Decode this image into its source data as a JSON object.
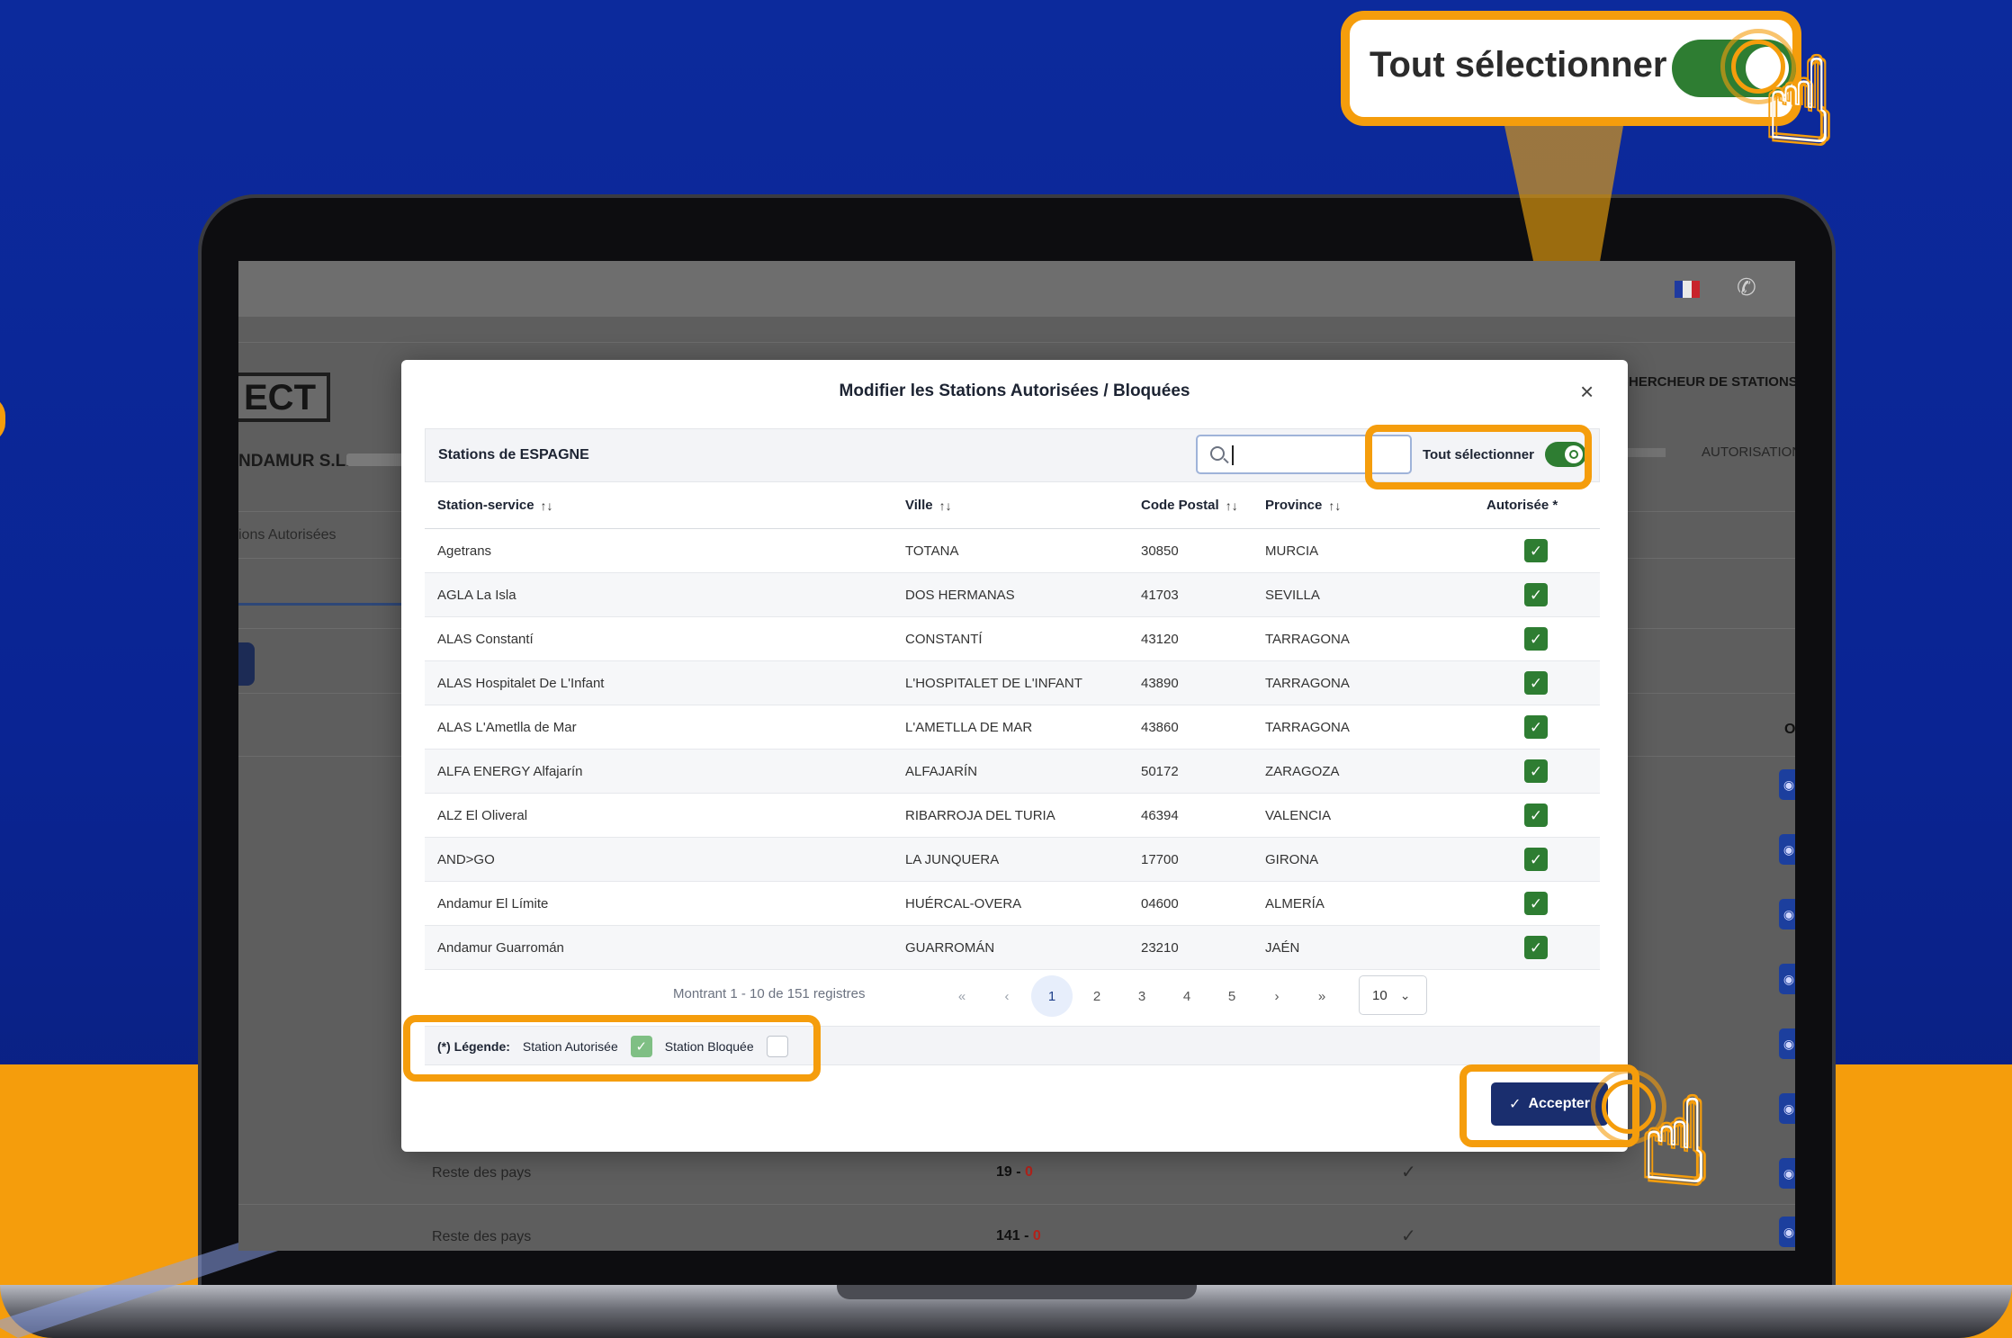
{
  "background_app": {
    "brand_logo_fragment": "ECT",
    "company_name": "NDAMUR S.L.",
    "tab_label": "ions Autorisées",
    "header_nav": "HERCHEUR DE STATIONS",
    "autorisation_label": "AUTORISATION",
    "column_fragment": "O",
    "rows": [
      {
        "label": "Reste des pays",
        "value_a": "19",
        "value_b": "0"
      },
      {
        "label": "Reste des pays",
        "value_a": "141",
        "value_b": "0"
      }
    ],
    "separator": " - ",
    "check_glyph": "✓"
  },
  "modal": {
    "title": "Modifier les Stations Autorisées / Bloquées",
    "close_glyph": "×",
    "panel_title": "Stations de ESPAGNE",
    "search": {
      "value": "",
      "placeholder": ""
    },
    "select_all_label": "Tout sélectionner",
    "select_all_on": true,
    "columns": {
      "station": "Station-service",
      "city": "Ville",
      "postal": "Code Postal",
      "province": "Province",
      "authorized": "Autorisée *"
    },
    "sort_glyph": "↑↓",
    "rows": [
      {
        "station": "Agetrans",
        "city": "TOTANA",
        "postal": "30850",
        "province": "MURCIA",
        "authorized": true
      },
      {
        "station": "AGLA La Isla",
        "city": "DOS HERMANAS",
        "postal": "41703",
        "province": "SEVILLA",
        "authorized": true
      },
      {
        "station": "ALAS Constantí",
        "city": "CONSTANTÍ",
        "postal": "43120",
        "province": "TARRAGONA",
        "authorized": true
      },
      {
        "station": "ALAS Hospitalet De L'Infant",
        "city": "L'HOSPITALET DE L'INFANT",
        "postal": "43890",
        "province": "TARRAGONA",
        "authorized": true
      },
      {
        "station": "ALAS L'Ametlla de Mar",
        "city": "L'AMETLLA DE MAR",
        "postal": "43860",
        "province": "TARRAGONA",
        "authorized": true
      },
      {
        "station": "ALFA ENERGY Alfajarín",
        "city": "ALFAJARÍN",
        "postal": "50172",
        "province": "ZARAGOZA",
        "authorized": true
      },
      {
        "station": "ALZ El Oliveral",
        "city": "RIBARROJA DEL TURIA",
        "postal": "46394",
        "province": "VALENCIA",
        "authorized": true
      },
      {
        "station": "AND>GO",
        "city": "LA JUNQUERA",
        "postal": "17700",
        "province": "GIRONA",
        "authorized": true
      },
      {
        "station": "Andamur El Límite",
        "city": "HUÉRCAL-OVERA",
        "postal": "04600",
        "province": "ALMERÍA",
        "authorized": true
      },
      {
        "station": "Andamur Guarromán",
        "city": "GUARROMÁN",
        "postal": "23210",
        "province": "JAÉN",
        "authorized": true
      }
    ],
    "pagination": {
      "info": "Montrant 1 - 10 de 151 registres",
      "first": "«",
      "prev": "‹",
      "pages": [
        "1",
        "2",
        "3",
        "4",
        "5"
      ],
      "current": "1",
      "next": "›",
      "last": "»",
      "page_size": "10"
    },
    "legend": {
      "label": "(*) Légende:",
      "authorized": "Station Autorisée",
      "blocked": "Station Bloquée"
    },
    "accept_label": "Accepter"
  },
  "callout": {
    "label": "Tout sélectionner",
    "toggle_on": true
  },
  "colors": {
    "background_blue": "#0c2a9c",
    "accent_orange": "#f59d0c",
    "toggle_green": "#2e7d32",
    "primary_navy": "#1a2e6e"
  },
  "icons": {
    "search": "search-icon",
    "sort": "sort-icon",
    "check": "check-icon",
    "close": "close-icon",
    "pointer": "hand-pointer-icon",
    "phone": "phone-icon",
    "flag": "flag-fr-icon"
  }
}
